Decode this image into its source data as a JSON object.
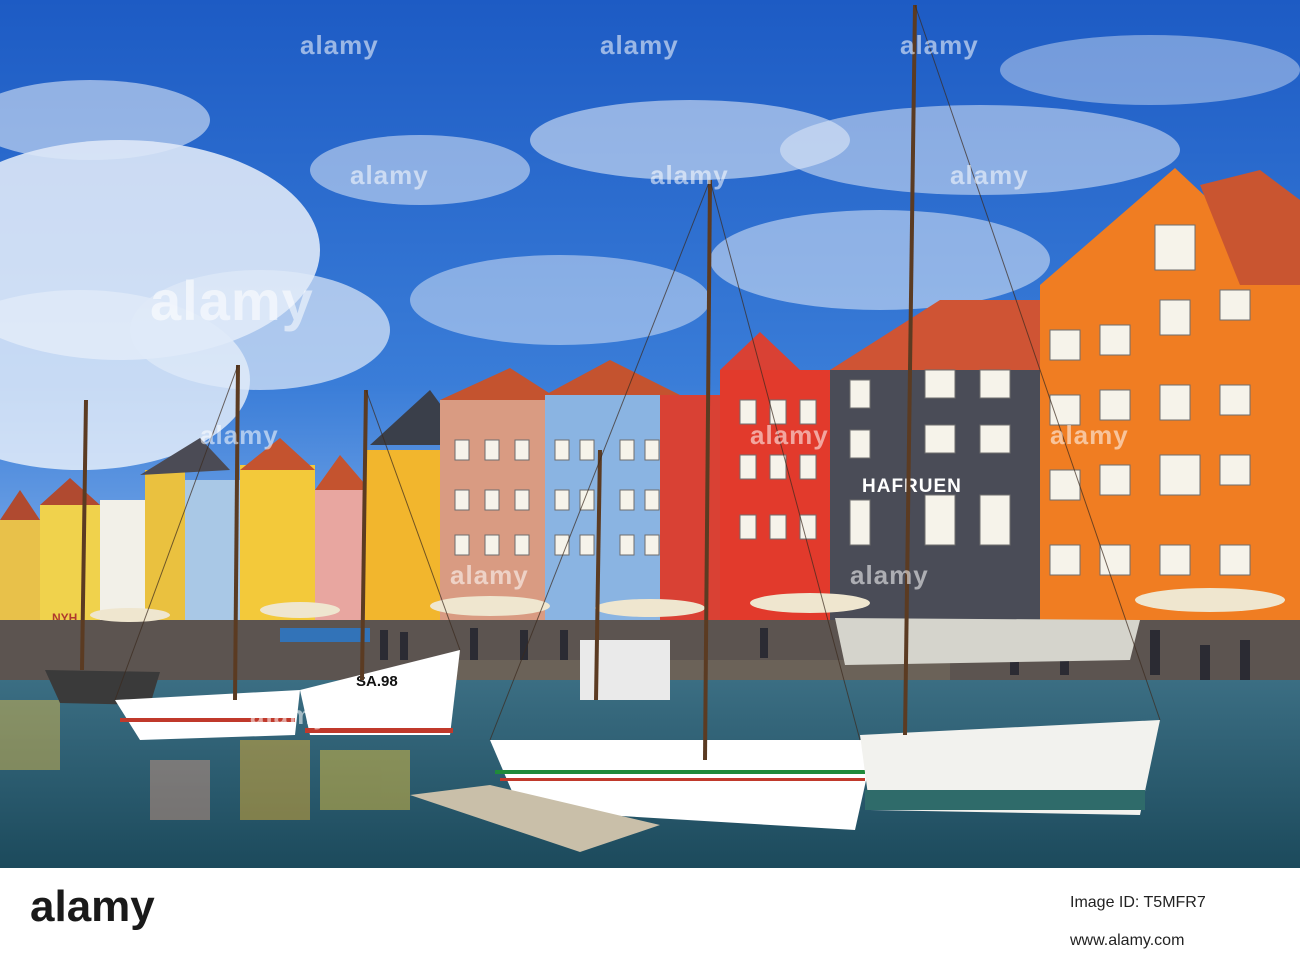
{
  "photo": {
    "signs": {
      "hafruen": "HAFRUEN",
      "boat_number": "SA.98",
      "nyhavn_fragment": "NYH"
    }
  },
  "watermark": {
    "brand": "alamy"
  },
  "footer": {
    "logo_text": "alamy",
    "image_id_label": "Image ID: T5MFR7",
    "image_id": "T5MFR7",
    "site": "www.alamy.com"
  }
}
